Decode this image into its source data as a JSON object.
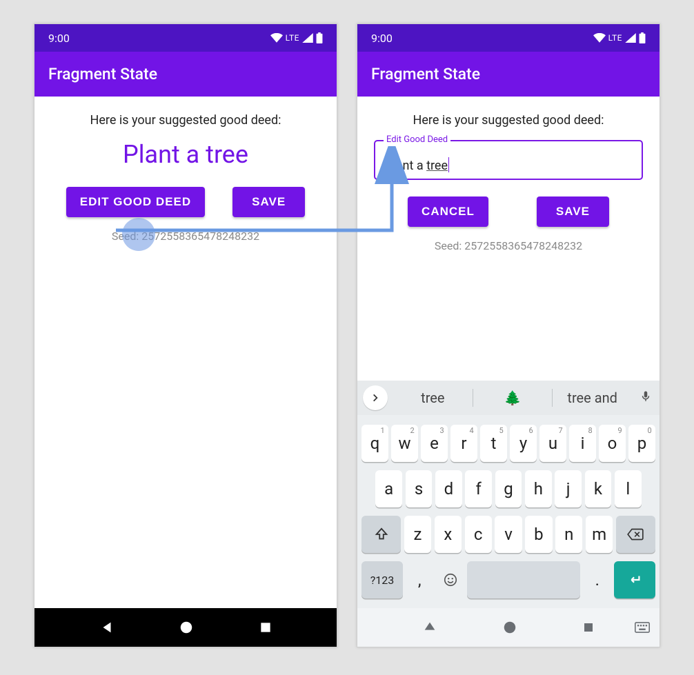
{
  "status": {
    "time": "9:00",
    "network": "LTE"
  },
  "appbar": {
    "title": "Fragment State"
  },
  "hint": "Here is your suggested good deed:",
  "deed": "Plant a tree",
  "buttons": {
    "edit": "EDIT GOOD DEED",
    "save": "SAVE",
    "cancel": "CANCEL"
  },
  "seed_label": "Seed: 2572558365478248232",
  "edit_field": {
    "label": "Edit Good Deed",
    "value_plain": "Plant a ",
    "value_underlined": "tree"
  },
  "keyboard": {
    "suggestions": {
      "left": "tree",
      "center": "🌲",
      "right": "tree and"
    },
    "row1": [
      {
        "k": "q",
        "n": "1"
      },
      {
        "k": "w",
        "n": "2"
      },
      {
        "k": "e",
        "n": "3"
      },
      {
        "k": "r",
        "n": "4"
      },
      {
        "k": "t",
        "n": "5"
      },
      {
        "k": "y",
        "n": "6"
      },
      {
        "k": "u",
        "n": "7"
      },
      {
        "k": "i",
        "n": "8"
      },
      {
        "k": "o",
        "n": "9"
      },
      {
        "k": "p",
        "n": "0"
      }
    ],
    "row2": [
      "a",
      "s",
      "d",
      "f",
      "g",
      "h",
      "j",
      "k",
      "l"
    ],
    "row3": [
      "z",
      "x",
      "c",
      "v",
      "b",
      "n",
      "m"
    ],
    "row4": {
      "sym": "?123",
      "comma": ",",
      "period": "."
    }
  },
  "colors": {
    "primary": "#7214e6",
    "primaryDark": "#4d14c2",
    "enter": "#16a89a"
  }
}
